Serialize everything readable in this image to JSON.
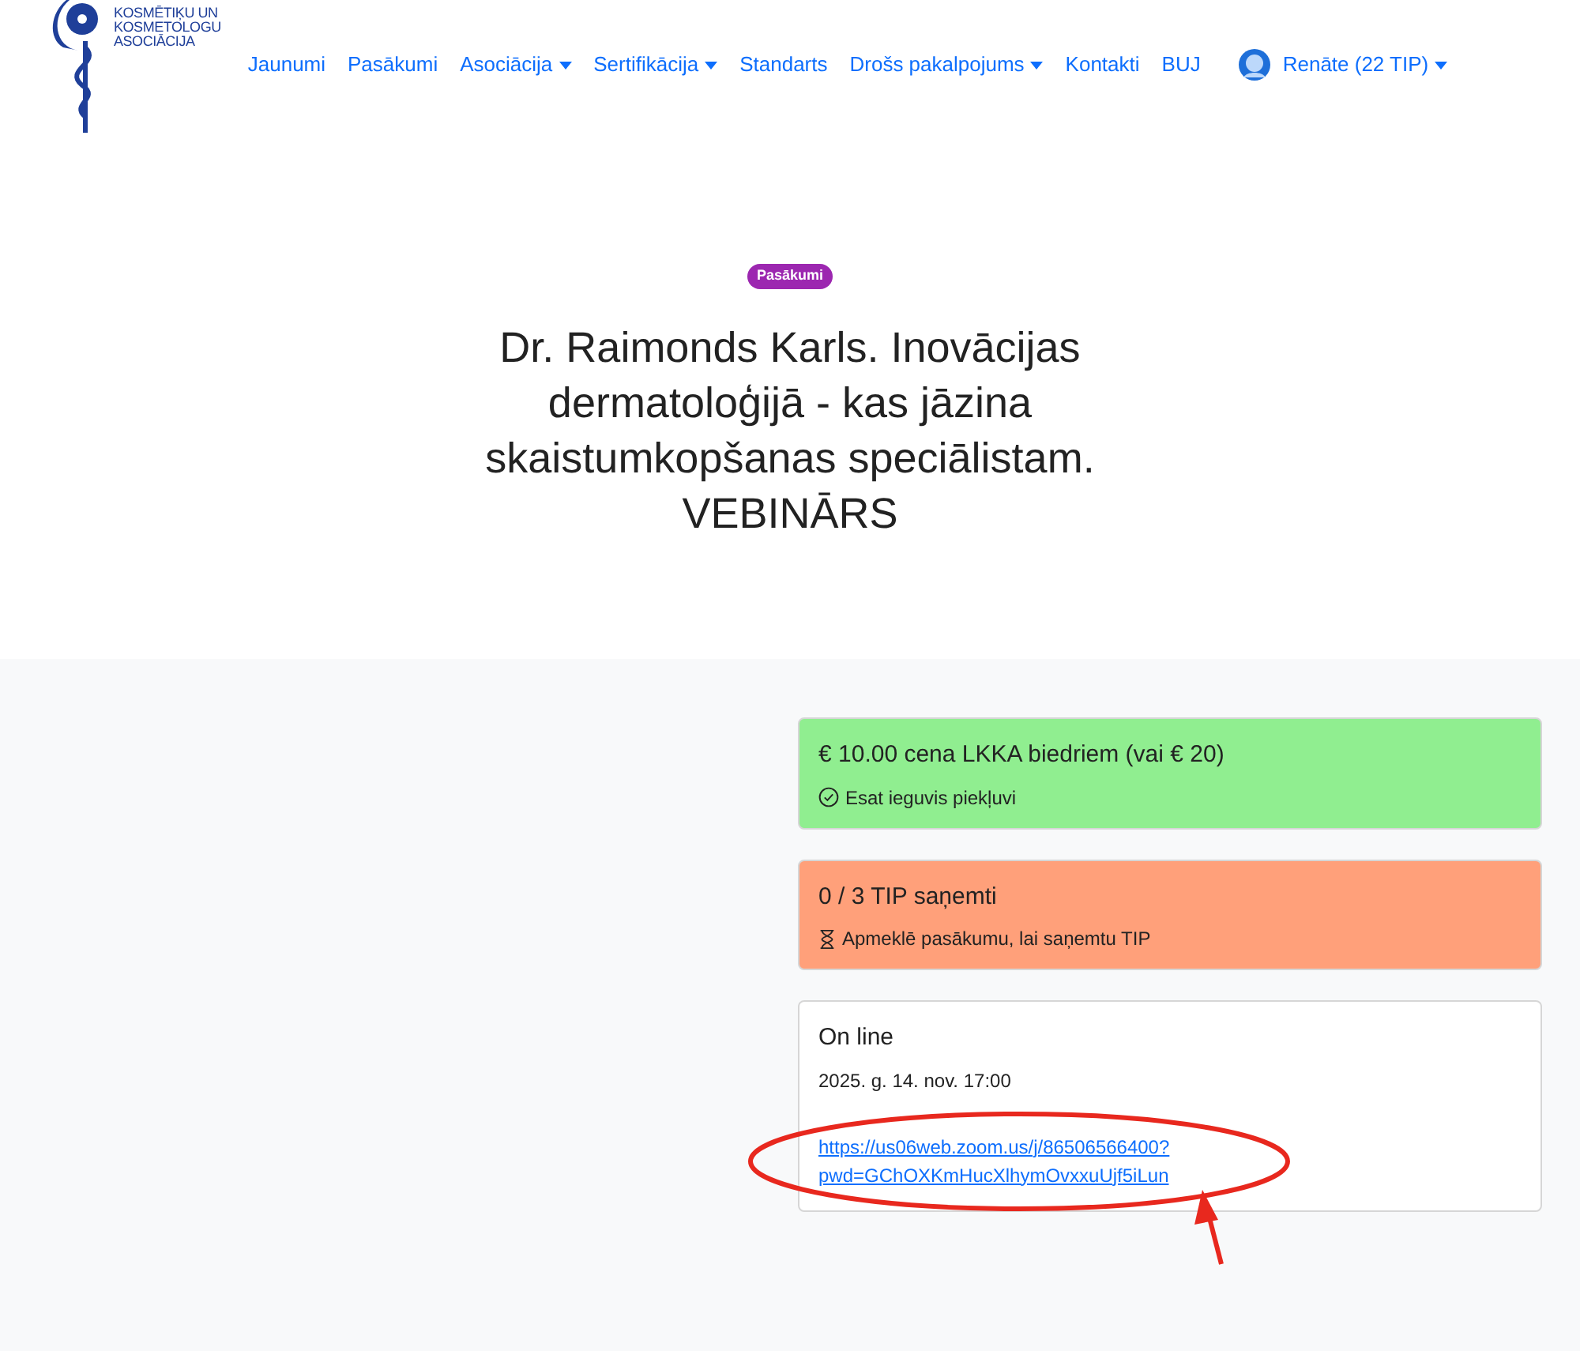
{
  "logo": {
    "lines": [
      "KOSMĒTIĶU UN",
      "KOSMETOLOGU",
      "ASOCIĀCIJA"
    ]
  },
  "nav": [
    {
      "label": "Jaunumi",
      "dropdown": false
    },
    {
      "label": "Pasākumi",
      "dropdown": false
    },
    {
      "label": "Asociācija",
      "dropdown": true
    },
    {
      "label": "Sertifikācija",
      "dropdown": true
    },
    {
      "label": "Standarts",
      "dropdown": false
    },
    {
      "label": "Drošs pakalpojums",
      "dropdown": true
    },
    {
      "label": "Kontakti",
      "dropdown": false
    },
    {
      "label": "BUJ",
      "dropdown": false
    }
  ],
  "user": {
    "label": "Renāte (22 TIP)",
    "dropdown": true
  },
  "event": {
    "category": "Pasākumi",
    "title": "Dr. Raimonds Karls. Inovācijas dermatoloģijā - kas jāzina skaistumkopšanas speciālistam. VEBINĀRS"
  },
  "cards": [
    {
      "kind": "price",
      "color": "#90ee90",
      "title": "€ 10.00 cena LKKA biedriem (vai € 20)",
      "note": "Esat ieguvis piekļuvi"
    },
    {
      "kind": "tip",
      "color": "#ffa07a",
      "title": "0 / 3 TIP saņemti",
      "note": "Apmeklē pasākumu, lai saņemtu TIP"
    },
    {
      "kind": "online",
      "color": "#ffffff",
      "title": "On line",
      "date": "2025. g. 14. nov. 17:00",
      "link": [
        "https://us06web.zoom.us/j/86506566400?",
        "pwd=GChOXKmHucXlhymOvxxuUjf5iLun"
      ]
    }
  ]
}
